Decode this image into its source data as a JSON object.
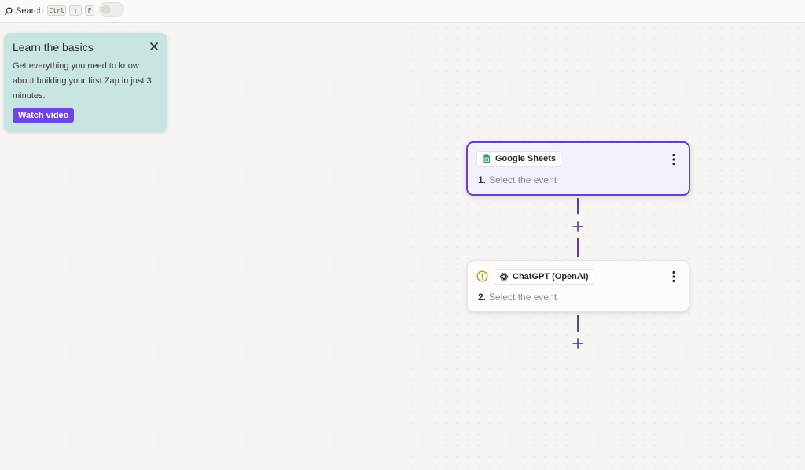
{
  "topbar": {
    "search_label": "Search",
    "shortcut_keys": [
      "Ctrl",
      "⇧",
      "F"
    ]
  },
  "learn": {
    "title": "Learn the basics",
    "description": "Get everything you need to know about building your first Zap in just 3 minutes.",
    "button_label": "Watch video"
  },
  "steps": [
    {
      "number": "1.",
      "app": "Google Sheets",
      "app_icon": "google-sheets-icon",
      "event_placeholder": "Select the event",
      "selected": true,
      "warning": false
    },
    {
      "number": "2.",
      "app": "ChatGPT (OpenAI)",
      "app_icon": "openai-icon",
      "event_placeholder": "Select the event",
      "selected": false,
      "warning": true
    }
  ],
  "colors": {
    "accent": "#6a3fc8",
    "button": "#6e45e2",
    "learn_card": "#c8e5e2",
    "warning": "#b59a1a",
    "sheets_green": "#1fa463"
  }
}
